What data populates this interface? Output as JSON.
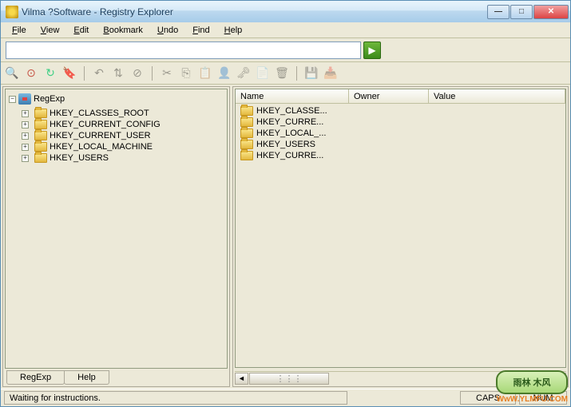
{
  "window": {
    "title": "Vilma ?Software - Registry Explorer"
  },
  "menu": {
    "file": "File",
    "view": "View",
    "edit": "Edit",
    "bookmark": "Bookmark",
    "undo": "Undo",
    "find": "Find",
    "help": "Help"
  },
  "search": {
    "value": "",
    "placeholder": ""
  },
  "tree": {
    "root": "RegExp",
    "items": [
      "HKEY_CLASSES_ROOT",
      "HKEY_CURRENT_CONFIG",
      "HKEY_CURRENT_USER",
      "HKEY_LOCAL_MACHINE",
      "HKEY_USERS"
    ]
  },
  "tabs": {
    "regexp": "RegExp",
    "help": "Help"
  },
  "list": {
    "columns": {
      "name": "Name",
      "owner": "Owner",
      "value": "Value"
    },
    "rows": [
      "HKEY_CLASSE...",
      "HKEY_CURRE...",
      "HKEY_LOCAL_...",
      "HKEY_USERS",
      "HKEY_CURRE..."
    ]
  },
  "status": {
    "message": "Waiting for instructions.",
    "caps": "CAPS",
    "num": "NUM"
  },
  "watermark": {
    "logo": "雨林 木风",
    "url": "WwW.YLMFU.COM"
  }
}
